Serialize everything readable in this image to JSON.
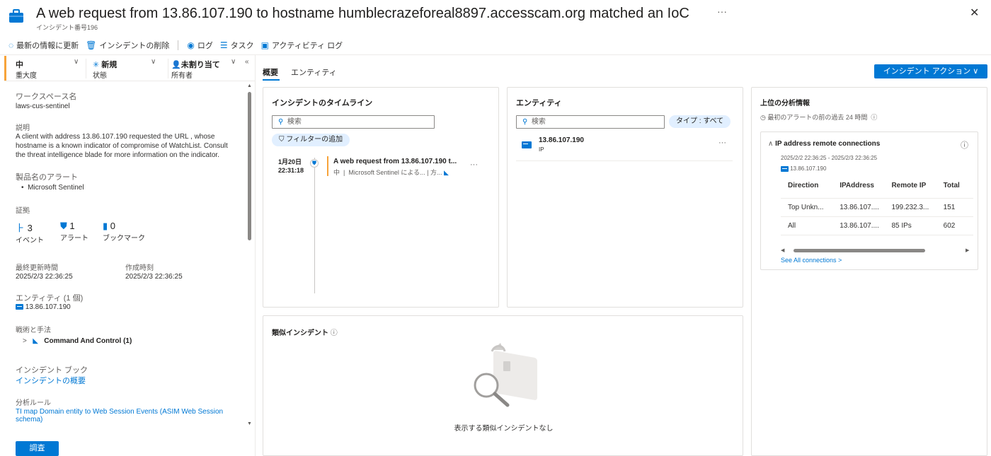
{
  "header": {
    "title": "A web request from 13.86.107.190 to hostname humblecrazeforeal8897.accesscam.org matched an IoC",
    "subtitle": "インシデント番号196",
    "more": "···",
    "close": "✕"
  },
  "toolbar": {
    "refresh": "最新の情報に更新",
    "delete": "インシデントの削除",
    "logs": "ログ",
    "tasks": "タスク",
    "activity_log": "アクティビティ ログ"
  },
  "status": {
    "severity_value": "中",
    "severity_label": "重大度",
    "state_value": "新規",
    "state_label": "状態",
    "owner_value": "未割り当て",
    "owner_label": "所有者"
  },
  "details": {
    "workspace_label": "ワークスペース名",
    "workspace_value": "laws-cus-sentinel",
    "description_label": "説明",
    "description_line1": "A client with address 13.86.107.190 requested the URL , whose",
    "description_line2": "hostname is a known indicator of compromise of WatchList. Consult",
    "description_line3": "the threat intelligence blade for more information on the indicator.",
    "product_label": "製品名のアラート",
    "product_value": "Microsoft Sentinel",
    "evidence_label": "証拠",
    "events_count": "3",
    "events_label": "イベント",
    "alerts_count": "1",
    "alerts_label": "アラート",
    "bookmarks_count": "0",
    "bookmarks_label": "ブックマーク",
    "last_updated_label": "最終更新時間",
    "last_updated_value": "2025/2/3 22:36:25",
    "created_label": "作成時刻",
    "created_value": "2025/2/3 22:36:25",
    "entities_label": "エンティティ (1 個)",
    "entity_ip": "13.86.107.190",
    "tactics_label": "戦術と手法",
    "tactic_value": "Command And Control (1)",
    "workbook_label": "インシデント ブック",
    "workbook_link": "インシデントの概要",
    "rule_label": "分析ルール",
    "rule_link_line1": "TI map Domain entity to Web Session Events (ASIM Web Session",
    "rule_link_line2": "schema)"
  },
  "investigate_button": "調査",
  "tabs": {
    "overview": "概要",
    "entities": "エンティティ"
  },
  "incident_action_button": "インシデント アクション ∨",
  "timeline": {
    "title": "インシデントのタイムライン",
    "search_placeholder": "検索",
    "filter_label": "フィルターの追加",
    "item_date": "1月20日",
    "item_time": "22:31:18",
    "item_title": "A web request from 13.86.107.190 t...",
    "item_sev": "中",
    "item_source": "Microsoft Sentinel による...",
    "item_tail": "方...",
    "item_more": "···"
  },
  "entities_card": {
    "title": "エンティティ",
    "search_placeholder": "検索",
    "type_filter": "タイプ : すべて",
    "entity_name": "13.86.107.190",
    "entity_type": "IP",
    "more": "···"
  },
  "similar": {
    "title": "類似インシデント",
    "empty_text": "表示する類似インシデントなし"
  },
  "insights": {
    "title": "上位の分析情報",
    "subtitle": "最初のアラートの前の過去 24 時間",
    "card_title": "IP address remote connections",
    "card_range": "2025/2/2 22:36:25 - 2025/2/3 22:36:25",
    "card_ip": "13.86.107.190",
    "columns": [
      "Direction",
      "IPAddress",
      "Remote IP",
      "Total"
    ],
    "rows": [
      [
        "Top Unkn...",
        "13.86.107....",
        "199.232.3...",
        "151"
      ],
      [
        "All",
        "13.86.107....",
        "85 IPs",
        "602"
      ]
    ],
    "see_all": "See All connections >"
  },
  "colors": {
    "accent": "#0078d4",
    "severity_medium": "#f7a33a"
  }
}
